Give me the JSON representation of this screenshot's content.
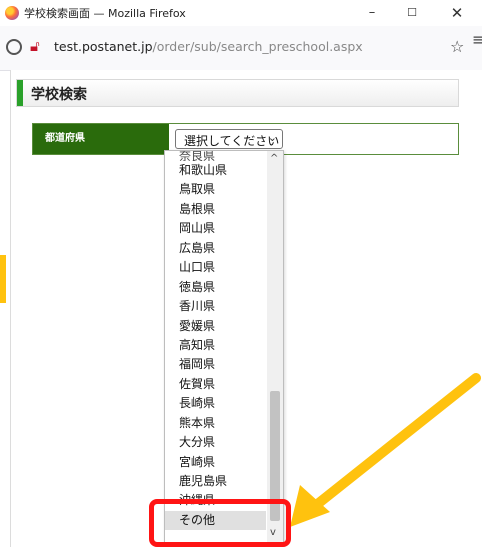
{
  "window": {
    "title": "学校検索画面 — Mozilla Firefox"
  },
  "urlbar": {
    "url_host": "test.postanet.jp",
    "url_path": "/order/sub/search_preschool.aspx"
  },
  "page": {
    "heading": "学校検索"
  },
  "form": {
    "prefecture_label": "都道府県",
    "prefecture_selected": "選択してください"
  },
  "dropdown": {
    "options": [
      "奈良県",
      "和歌山県",
      "鳥取県",
      "島根県",
      "岡山県",
      "広島県",
      "山口県",
      "徳島県",
      "香川県",
      "愛媛県",
      "高知県",
      "福岡県",
      "佐賀県",
      "長崎県",
      "熊本県",
      "大分県",
      "宮崎県",
      "鹿児島県",
      "沖縄県",
      "その他"
    ],
    "highlighted": "その他"
  },
  "colors": {
    "accent_green": "#2aa12a",
    "label_green": "#2a6b0c",
    "highlight_red": "#ff1414",
    "arrow_yellow": "#ffc20e"
  }
}
